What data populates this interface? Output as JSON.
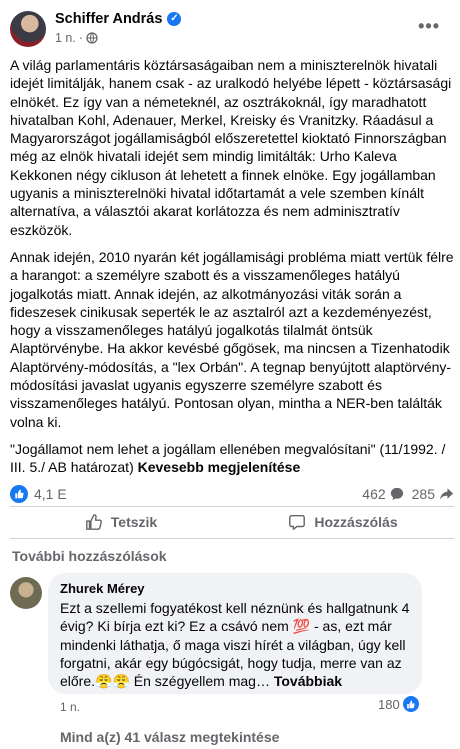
{
  "post": {
    "author": "Schiffer András",
    "time": "1 n.",
    "paragraphs": [
      "A világ parlamentáris köztársaságaiban nem a miniszterelnök hivatali idejét limitálják, hanem csak - az uralkodó helyébe lépett - köztársasági elnökét. Ez így van a németeknél, az osztrákoknál, így maradhatott hivatalban  Kohl, Adenauer, Merkel, Kreisky és Vranitzky. Ráadásul a Magyarországot jogállamiságból előszeretettel kioktató Finnországban még az elnök hivatali idejét sem mindig limitálták: Urho Kaleva Kekkonen négy cikluson át lehetett a finnek elnöke. Egy jogállamban ugyanis a miniszterelnöki hivatal időtartamát a vele szemben kínált alternatíva, a választói akarat korlátozza és nem adminisztratív eszközök.",
      "Annak idején, 2010 nyarán két jogállamisági probléma miatt vertük félre a harangot: a személyre szabott és a visszamenőleges hatályú jogalkotás miatt. Annak idején, az alkotmányozási viták során a fideszesek cinikusak seperték le az asztalról azt a kezdeményezést, hogy a visszamenőleges hatályú jogalkotás tilalmát öntsük Alaptörvénybe. Ha akkor kevésbé gőgösek, ma nincsen a Tizenhatodik Alaptörvény-módosítás, a \"lex Orbán\". A tegnap benyújtott alaptörvény-módosítási javaslat ugyanis egyszerre személyre szabott és visszamenőleges hatályú. Pontosan olyan, mintha a NER-ben találták volna ki."
    ],
    "quote": "\"Jogállamot nem lehet a jogállam ellenében  megvalósítani\" (11/1992. / III. 5./ AB határozat)",
    "see_less": "Kevesebb megjelenítése"
  },
  "stats": {
    "reactions": "4,1 E",
    "comments": "462",
    "shares": "285"
  },
  "actions": {
    "like": "Tetszik",
    "comment": "Hozzászólás"
  },
  "comments_section": {
    "more_label": "További hozzászólások",
    "comment": {
      "author": "Zhurek Mérey",
      "text": "Ezt a szellemi fogyatékost kell néznünk és hallgatnunk 4 évig? Ki bírja ezt ki? Ez a csávó nem 💯 - as, ezt már mindenki láthatja, ő maga viszi hírét a világban, úgy kell forgatni, akár egy búgócsigát, hogy tudja, merre van az előre.😤😤 Én szégyellem mag…",
      "more": "Továbbiak",
      "time": "1 n.",
      "reactions": "180"
    },
    "view_replies": "Mind a(z) 41 válasz megtekintése"
  },
  "colors": {
    "accent": "#1877f2",
    "secondary_text": "#65676b",
    "bubble": "#f0f2f5"
  },
  "icons": [
    "verified-icon",
    "globe-icon",
    "more-icon",
    "like-reaction-icon",
    "comment-count-icon",
    "share-count-icon",
    "thumbs-up-icon",
    "comment-icon"
  ]
}
